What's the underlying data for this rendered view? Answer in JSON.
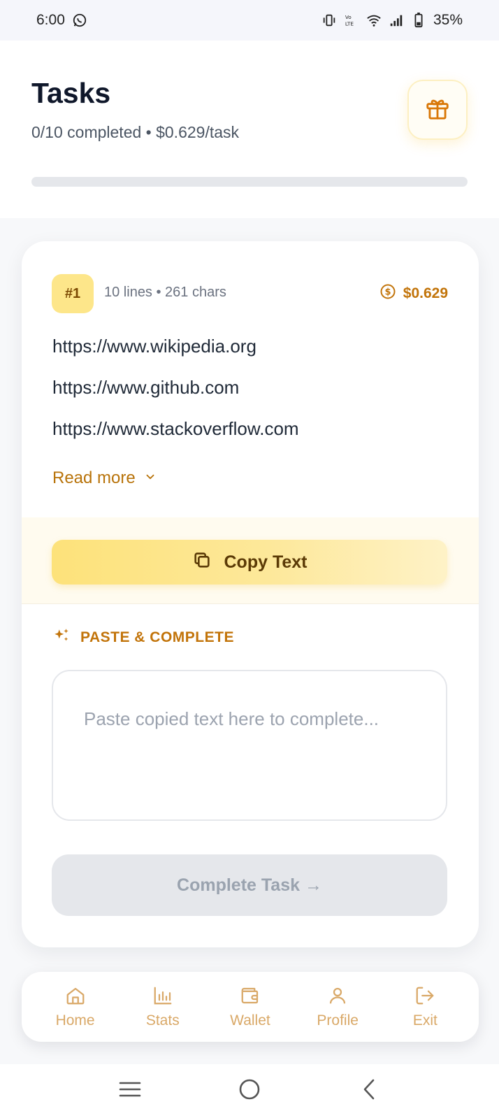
{
  "status_bar": {
    "time": "6:00",
    "battery": "35%"
  },
  "header": {
    "title": "Tasks",
    "subtitle": "0/10 completed • $0.629/task",
    "progress": 0,
    "gift_icon": "gift-icon"
  },
  "task": {
    "badge": "#1",
    "meta": "10 lines • 261 chars",
    "reward": "$0.629",
    "lines": [
      "https://www.wikipedia.org",
      "https://www.github.com",
      "https://www.stackoverflow.com"
    ],
    "read_more": "Read more",
    "copy_label": "Copy Text",
    "paste_label": "PASTE & COMPLETE",
    "paste_placeholder": "Paste copied text here to complete...",
    "paste_value": "",
    "complete_label": "Complete Task →"
  },
  "nav": {
    "items": [
      {
        "label": "Home",
        "icon": "home-icon"
      },
      {
        "label": "Stats",
        "icon": "chart-icon"
      },
      {
        "label": "Wallet",
        "icon": "wallet-icon"
      },
      {
        "label": "Profile",
        "icon": "user-icon"
      },
      {
        "label": "Exit",
        "icon": "logout-icon"
      }
    ]
  },
  "colors": {
    "accent": "#c2740a",
    "accent_light": "#fde68a",
    "nav_inactive": "#d9a867"
  }
}
